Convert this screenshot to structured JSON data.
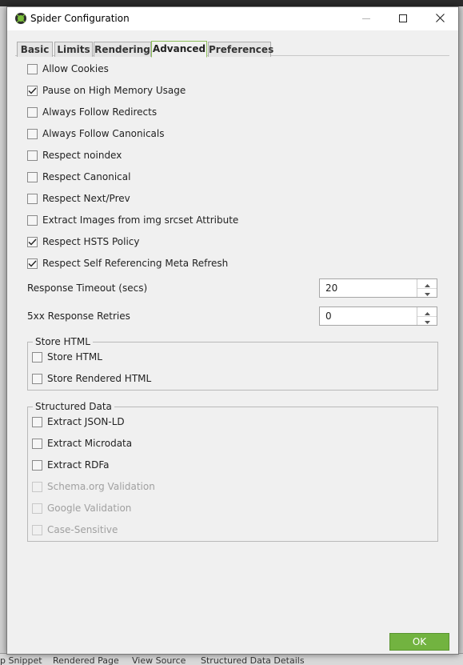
{
  "window": {
    "title": "Spider Configuration"
  },
  "tabs": [
    {
      "label": "Basic"
    },
    {
      "label": "Limits"
    },
    {
      "label": "Rendering"
    },
    {
      "label": "Advanced"
    },
    {
      "label": "Preferences"
    }
  ],
  "active_tab": "Advanced",
  "advanced": {
    "options": [
      {
        "label": "Allow Cookies",
        "checked": false
      },
      {
        "label": "Pause on High Memory Usage",
        "checked": true
      },
      {
        "label": "Always Follow Redirects",
        "checked": false
      },
      {
        "label": "Always Follow Canonicals",
        "checked": false
      },
      {
        "label": "Respect noindex",
        "checked": false
      },
      {
        "label": "Respect Canonical",
        "checked": false
      },
      {
        "label": "Respect Next/Prev",
        "checked": false
      },
      {
        "label": "Extract Images from img srcset Attribute",
        "checked": false
      },
      {
        "label": "Respect HSTS Policy",
        "checked": true
      },
      {
        "label": "Respect Self Referencing Meta Refresh",
        "checked": true
      }
    ],
    "response_timeout": {
      "label": "Response Timeout (secs)",
      "value": "20"
    },
    "retries": {
      "label": "5xx Response Retries",
      "value": "0"
    }
  },
  "store_html": {
    "title": "Store HTML",
    "options": [
      {
        "label": "Store HTML",
        "checked": false
      },
      {
        "label": "Store Rendered HTML",
        "checked": false
      }
    ]
  },
  "structured_data": {
    "title": "Structured Data",
    "options": [
      {
        "label": "Extract JSON-LD",
        "checked": false,
        "disabled": false
      },
      {
        "label": "Extract Microdata",
        "checked": false,
        "disabled": false
      },
      {
        "label": "Extract RDFa",
        "checked": false,
        "disabled": false
      },
      {
        "label": "Schema.org Validation",
        "checked": false,
        "disabled": true
      },
      {
        "label": "Google Validation",
        "checked": false,
        "disabled": true
      },
      {
        "label": "Case-Sensitive",
        "checked": false,
        "disabled": true
      }
    ]
  },
  "ok_label": "OK",
  "background_tabs": [
    "p Snippet",
    "Rendered Page",
    "View Source",
    "Structured Data Details"
  ],
  "colors": {
    "accent": "#72b340",
    "active_tab_border": "#8dc05a"
  }
}
